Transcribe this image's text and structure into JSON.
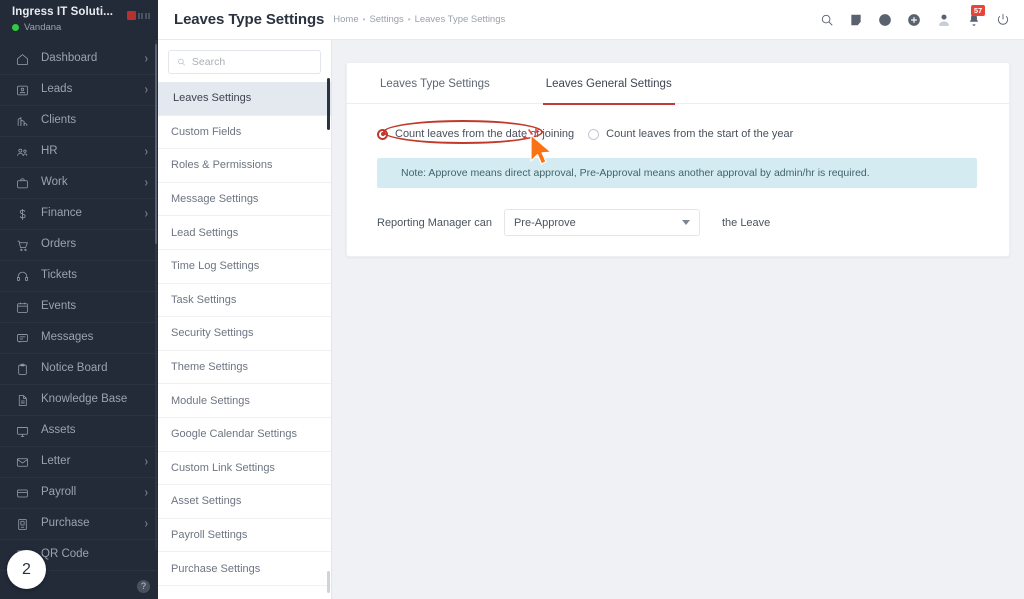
{
  "colors": {
    "sidebar_bg": "#232b39",
    "accent_red": "#bf3b3b",
    "annotation_red": "#c0392b",
    "cursor_orange": "#f97316",
    "note_bg": "#d4ecf1",
    "badge_red": "#e8443a",
    "status_green": "#2ecc40"
  },
  "sidebar": {
    "company_name": "Ingress IT Soluti...",
    "user_name": "Vandana",
    "step_badge": "2",
    "help_icon": "?",
    "items": [
      {
        "label": "Dashboard",
        "icon": "home-icon",
        "has_chevron": true
      },
      {
        "label": "Leads",
        "icon": "leads-icon",
        "has_chevron": true
      },
      {
        "label": "Clients",
        "icon": "clients-icon",
        "has_chevron": false
      },
      {
        "label": "HR",
        "icon": "hr-people-icon",
        "has_chevron": true
      },
      {
        "label": "Work",
        "icon": "briefcase-icon",
        "has_chevron": true
      },
      {
        "label": "Finance",
        "icon": "dollar-icon",
        "has_chevron": true
      },
      {
        "label": "Orders",
        "icon": "cart-icon",
        "has_chevron": false
      },
      {
        "label": "Tickets",
        "icon": "headset-icon",
        "has_chevron": false
      },
      {
        "label": "Events",
        "icon": "calendar-icon",
        "has_chevron": false
      },
      {
        "label": "Messages",
        "icon": "chat-icon",
        "has_chevron": false
      },
      {
        "label": "Notice Board",
        "icon": "clipboard-icon",
        "has_chevron": false
      },
      {
        "label": "Knowledge Base",
        "icon": "document-icon",
        "has_chevron": false
      },
      {
        "label": "Assets",
        "icon": "monitor-icon",
        "has_chevron": false
      },
      {
        "label": "Letter",
        "icon": "envelope-icon",
        "has_chevron": true
      },
      {
        "label": "Payroll",
        "icon": "wallet-icon",
        "has_chevron": true
      },
      {
        "label": "Purchase",
        "icon": "purchase-icon",
        "has_chevron": true
      },
      {
        "label": "QR Code",
        "icon": "qr-icon",
        "has_chevron": false
      }
    ]
  },
  "topbar": {
    "page_title": "Leaves Type Settings",
    "breadcrumb": [
      "Home",
      "Settings",
      "Leaves Type Settings"
    ],
    "breadcrumb_separator": "•",
    "icons": [
      {
        "name": "search-icon"
      },
      {
        "name": "note-icon"
      },
      {
        "name": "clock-icon"
      },
      {
        "name": "plus-circle-icon"
      },
      {
        "name": "user-avatar"
      },
      {
        "name": "bell-icon",
        "badge": "57"
      },
      {
        "name": "power-icon"
      }
    ]
  },
  "settings_panel": {
    "search": {
      "placeholder": "Search",
      "value": ""
    },
    "items": [
      "Leaves Settings",
      "Custom Fields",
      "Roles & Permissions",
      "Message Settings",
      "Lead Settings",
      "Time Log Settings",
      "Task Settings",
      "Security Settings",
      "Theme Settings",
      "Module Settings",
      "Google Calendar Settings",
      "Custom Link Settings",
      "Asset Settings",
      "Payroll Settings",
      "Purchase Settings"
    ],
    "active_index": 0
  },
  "main": {
    "tabs": [
      {
        "label": "Leaves Type Settings",
        "active": false
      },
      {
        "label": "Leaves General Settings",
        "active": true
      }
    ],
    "radio_options": [
      {
        "label": "Count leaves from the date of joining",
        "checked": true,
        "annotated": true
      },
      {
        "label": "Count leaves from the start of the year",
        "checked": false,
        "annotated": false
      }
    ],
    "note": "Note: Approve means direct approval, Pre-Approval means another approval by admin/hr is required.",
    "manager_label": "Reporting Manager can",
    "manager_select_value": "Pre-Approve",
    "manager_suffix": "the Leave"
  }
}
